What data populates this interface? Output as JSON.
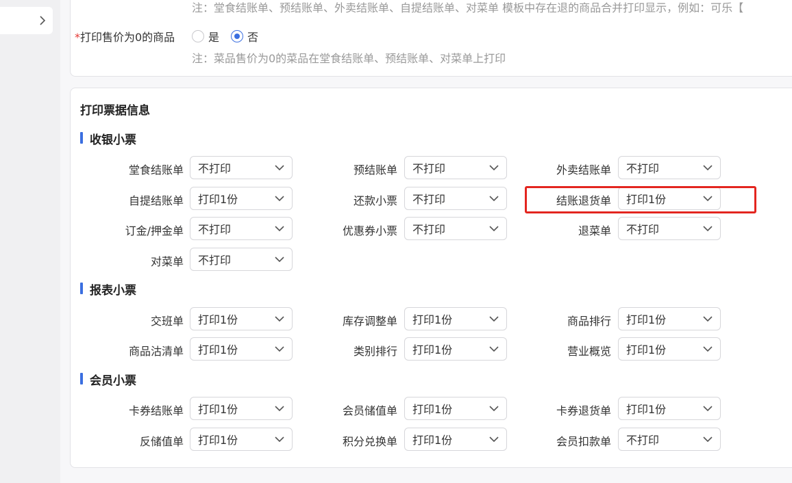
{
  "top": {
    "note_top": "注：堂食结账单、预结账单、外卖结账单、自提结账单、对菜单 模板中存在退的商品合并打印显示，例如：可乐【",
    "zero_price": {
      "required_mark": "*",
      "label": "打印售价为0的商品",
      "options": [
        "是",
        "否"
      ],
      "note": "注：菜品售价为0的菜品在堂食结账单、预结账单、对菜单上打印"
    }
  },
  "section_title": "打印票据信息",
  "groups": [
    {
      "title": "收银小票",
      "fields": [
        {
          "label": "堂食结账单",
          "value": "不打印"
        },
        {
          "label": "预结账单",
          "value": "不打印"
        },
        {
          "label": "外卖结账单",
          "value": "不打印"
        },
        {
          "label": "自提结账单",
          "value": "打印1份"
        },
        {
          "label": "还款小票",
          "value": "不打印"
        },
        {
          "label": "结账退货单",
          "value": "打印1份"
        },
        {
          "label": "订金/押金单",
          "value": "不打印"
        },
        {
          "label": "优惠券小票",
          "value": "不打印"
        },
        {
          "label": "退菜单",
          "value": "不打印"
        },
        {
          "label": "对菜单",
          "value": "不打印"
        }
      ]
    },
    {
      "title": "报表小票",
      "fields": [
        {
          "label": "交班单",
          "value": "打印1份"
        },
        {
          "label": "库存调整单",
          "value": "打印1份"
        },
        {
          "label": "商品排行",
          "value": "打印1份"
        },
        {
          "label": "商品沽清单",
          "value": "打印1份"
        },
        {
          "label": "类别排行",
          "value": "打印1份"
        },
        {
          "label": "营业概览",
          "value": "打印1份"
        }
      ]
    },
    {
      "title": "会员小票",
      "fields": [
        {
          "label": "卡券结账单",
          "value": "打印1份"
        },
        {
          "label": "会员储值单",
          "value": "打印1份"
        },
        {
          "label": "卡券退货单",
          "value": "打印1份"
        },
        {
          "label": "反储值单",
          "value": "打印1份"
        },
        {
          "label": "积分兑换单",
          "value": "打印1份"
        },
        {
          "label": "会员扣款单",
          "value": "不打印"
        }
      ]
    }
  ],
  "colors": {
    "accent": "#3b6fe0",
    "highlight": "#e3251f"
  }
}
